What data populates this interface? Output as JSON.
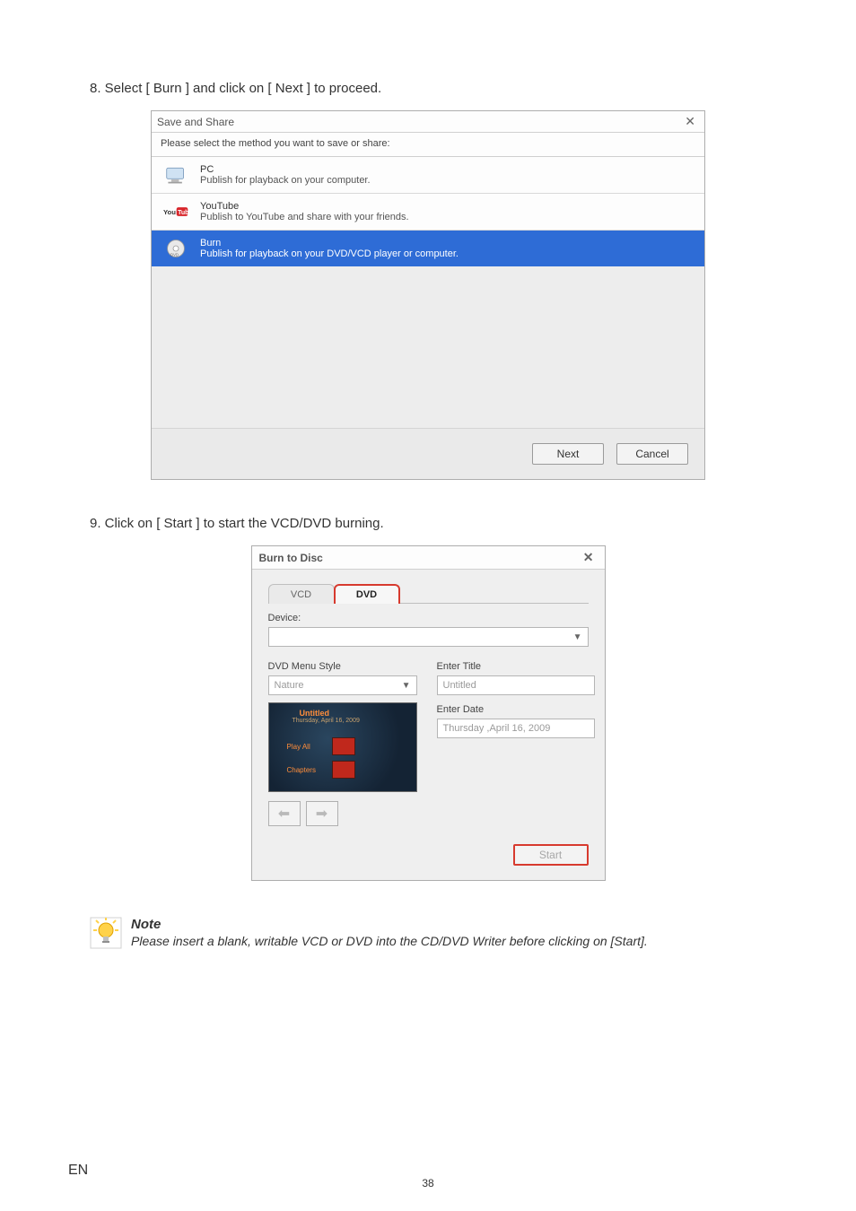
{
  "step8": "8. Select [ Burn ] and click on [ Next ] to proceed.",
  "step9": "9. Click on [ Start ] to start the VCD/DVD burning.",
  "dlg1": {
    "title": "Save and Share",
    "close": "✕",
    "subtitle": "Please select the method you want to save or share:",
    "options": {
      "pc": {
        "title": "PC",
        "desc": "Publish for playback on your computer."
      },
      "yt": {
        "title": "YouTube",
        "desc": "Publish to YouTube and share with your friends."
      },
      "burn": {
        "title": "Burn",
        "desc": "Publish for playback on your DVD/VCD player or computer."
      }
    },
    "next": "Next",
    "cancel": "Cancel"
  },
  "dlg2": {
    "title": "Burn to Disc",
    "close": "✕",
    "tab_vcd": "VCD",
    "tab_dvd": "DVD",
    "device_lbl": "Device:",
    "menu_lbl": "DVD Menu Style",
    "menu_val": "Nature",
    "title_lbl": "Enter Title",
    "title_val": "Untitled",
    "date_lbl": "Enter Date",
    "date_val": "Thursday ,April 16, 2009",
    "prev_title": "Untitled",
    "prev_date": "Thursday, April 16, 2009",
    "prev_play": "Play All",
    "prev_chap": "Chapters",
    "nav_left": "⬅",
    "nav_right": "➡",
    "start": "Start"
  },
  "note": {
    "title": "Note",
    "body": "Please insert a blank, writable VCD or DVD into the CD/DVD Writer before clicking on [Start]."
  },
  "footer": {
    "en": "EN",
    "pg": "38"
  }
}
